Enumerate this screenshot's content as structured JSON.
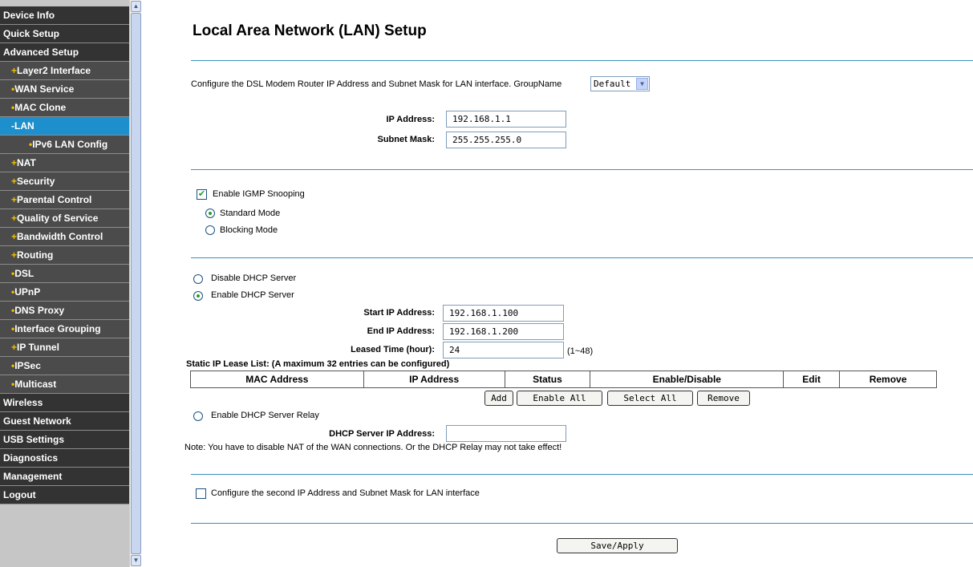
{
  "sidebar": {
    "items": [
      {
        "label": "Device Info",
        "type": "top"
      },
      {
        "label": "Quick Setup",
        "type": "top"
      },
      {
        "label": "Advanced Setup",
        "type": "top"
      },
      {
        "label": "Layer2 Interface",
        "type": "sub",
        "bullet": "+"
      },
      {
        "label": "WAN Service",
        "type": "sub",
        "bullet": "•"
      },
      {
        "label": "MAC Clone",
        "type": "sub",
        "bullet": "•"
      },
      {
        "label": "LAN",
        "type": "sub",
        "bullet": "-",
        "active": true
      },
      {
        "label": "IPv6 LAN Config",
        "type": "sub2",
        "bullet": "•"
      },
      {
        "label": "NAT",
        "type": "sub",
        "bullet": "+"
      },
      {
        "label": "Security",
        "type": "sub",
        "bullet": "+"
      },
      {
        "label": "Parental Control",
        "type": "sub",
        "bullet": "+"
      },
      {
        "label": "Quality of Service",
        "type": "sub",
        "bullet": "+"
      },
      {
        "label": "Bandwidth Control",
        "type": "sub",
        "bullet": "+"
      },
      {
        "label": "Routing",
        "type": "sub",
        "bullet": "+"
      },
      {
        "label": "DSL",
        "type": "sub",
        "bullet": "•"
      },
      {
        "label": "UPnP",
        "type": "sub",
        "bullet": "•"
      },
      {
        "label": "DNS Proxy",
        "type": "sub",
        "bullet": "•"
      },
      {
        "label": "Interface Grouping",
        "type": "sub",
        "bullet": "•"
      },
      {
        "label": "IP Tunnel",
        "type": "sub",
        "bullet": "+"
      },
      {
        "label": "IPSec",
        "type": "sub",
        "bullet": "•"
      },
      {
        "label": "Multicast",
        "type": "sub",
        "bullet": "•"
      },
      {
        "label": "Wireless",
        "type": "top"
      },
      {
        "label": "Guest Network",
        "type": "top"
      },
      {
        "label": "USB Settings",
        "type": "top"
      },
      {
        "label": "Diagnostics",
        "type": "top"
      },
      {
        "label": "Management",
        "type": "top"
      },
      {
        "label": "Logout",
        "type": "top"
      }
    ]
  },
  "page": {
    "title": "Local Area Network (LAN) Setup",
    "intro": "Configure the DSL Modem Router IP Address and Subnet Mask for LAN interface.  GroupName",
    "group_select": "Default",
    "ip_label": "IP Address:",
    "ip_value": "192.168.1.1",
    "mask_label": "Subnet Mask:",
    "mask_value": "255.255.255.0"
  },
  "igmp": {
    "enable_label": "Enable IGMP Snooping",
    "enabled": true,
    "standard_label": "Standard Mode",
    "blocking_label": "Blocking Mode",
    "mode": "standard"
  },
  "dhcp": {
    "disable_label": "Disable DHCP Server",
    "enable_label": "Enable DHCP Server",
    "selected": "enable",
    "start_label": "Start IP Address:",
    "start_value": "192.168.1.100",
    "end_label": "End IP Address:",
    "end_value": "192.168.1.200",
    "lease_label": "Leased Time (hour):",
    "lease_value": "24",
    "lease_hint": "(1~48)",
    "static_list_title": "Static IP Lease List: (A maximum 32 entries can be configured)",
    "columns": [
      "MAC Address",
      "IP Address",
      "Status",
      "Enable/Disable",
      "Edit",
      "Remove"
    ],
    "buttons": {
      "add": "Add",
      "enable_all": "Enable All",
      "select_all": "Select All",
      "remove": "Remove"
    },
    "relay_label": "Enable DHCP Server Relay",
    "relay_ip_label": "DHCP Server IP Address:",
    "relay_ip_value": "",
    "note": "Note: You have to disable NAT of the WAN connections. Or the DHCP Relay may not take effect!"
  },
  "second_ip": {
    "label": "Configure the second IP Address and Subnet Mask for LAN interface",
    "checked": false
  },
  "footer": {
    "save_label": "Save/Apply"
  },
  "colors": {
    "menu_bg": "#333333",
    "menu_active": "#1e8fcd",
    "menu_bullet": "#f0c000",
    "divider": "#3c8fc0"
  }
}
